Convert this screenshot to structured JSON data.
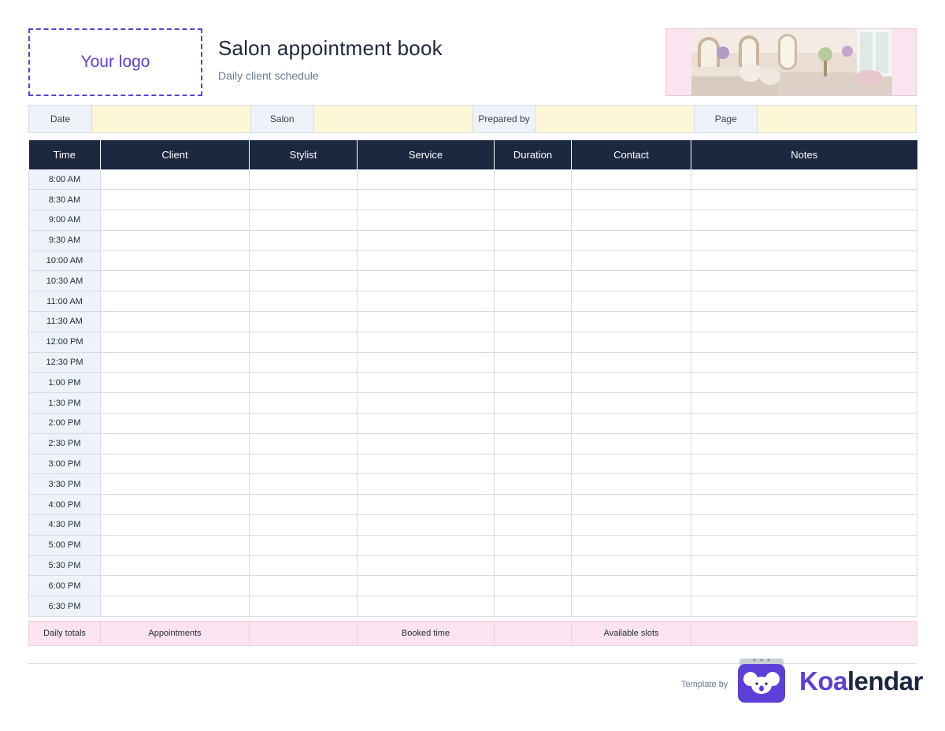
{
  "header": {
    "logo_placeholder": "Your logo",
    "title": "Salon appointment book",
    "subtitle": "Daily client schedule"
  },
  "meta": {
    "date_label": "Date",
    "salon_label": "Salon",
    "prepared_by_label": "Prepared by",
    "page_label": "Page"
  },
  "table": {
    "columns": [
      "Time",
      "Client",
      "Stylist",
      "Service",
      "Duration",
      "Contact",
      "Notes"
    ],
    "times": [
      "8:00 AM",
      "8:30 AM",
      "9:00 AM",
      "9:30 AM",
      "10:00 AM",
      "10:30 AM",
      "11:00 AM",
      "11:30 AM",
      "12:00 PM",
      "12:30 PM",
      "1:00 PM",
      "1:30 PM",
      "2:00 PM",
      "2:30 PM",
      "3:00 PM",
      "3:30 PM",
      "4:00 PM",
      "4:30 PM",
      "5:00 PM",
      "5:30 PM",
      "6:00 PM",
      "6:30 PM"
    ]
  },
  "totals": {
    "label": "Daily totals",
    "appointments": "Appointments",
    "booked_time": "Booked time",
    "available_slots": "Available slots"
  },
  "footer": {
    "template_by": "Template by",
    "brand_part1": "Koa",
    "brand_part2": "lendar"
  },
  "colors": {
    "accent": "#5b3fd6",
    "header_navy": "#1c2740",
    "field_yellow": "#fef7d7",
    "label_blue": "#eef2fb",
    "totals_pink": "#fbe4f0"
  },
  "icons": [
    "salon-photo",
    "koala-logo-icon"
  ]
}
